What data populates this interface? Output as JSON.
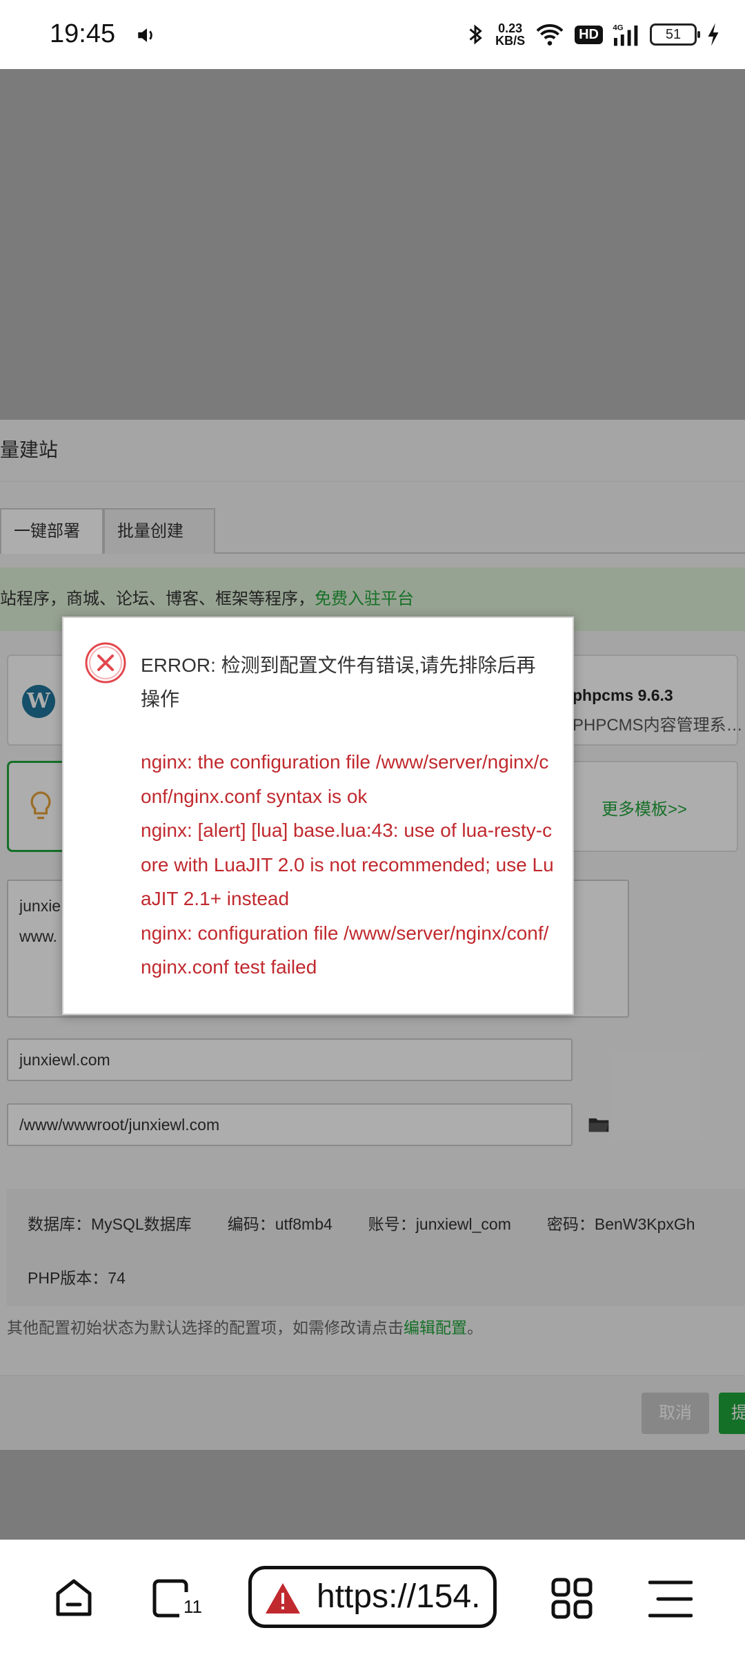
{
  "status_bar": {
    "time": "19:45",
    "speed_value": "0.23",
    "speed_unit": "KB/S",
    "network": "4G",
    "hd_label": "HD",
    "battery": "51"
  },
  "page": {
    "title_partial": "量建站",
    "tabs": [
      "一键部署",
      "批量创建"
    ],
    "notice_text": "站程序，商城、论坛、博客、框架等程序，",
    "notice_link": "免费入驻平台",
    "template1_name": "phpcms 9.6.3",
    "template1_desc": "PHPCMS内容管理系…",
    "more_templates": "更多模板>>",
    "textarea_line1": "junxie",
    "textarea_line2": "www.",
    "domain_value": "junxiewl.com",
    "path_value": "/www/wwwroot/junxiewl.com",
    "info": {
      "db": "数据库：MySQL数据库",
      "encoding": "编码：utf8mb4",
      "account": "账号：junxiewl_com",
      "password": "密码：BenW3KpxGh",
      "php": "PHP版本：74"
    },
    "tip_text": "其他配置初始状态为默认选择的配置项，如需修改请点击",
    "tip_link": "编辑配置",
    "tip_end": "。",
    "cancel_label": "取消",
    "ok_label": "提"
  },
  "dialog": {
    "title": "ERROR: 检测到配置文件有错误,请先排除后再操作",
    "lines": [
      "nginx: the configuration file /www/server/nginx/conf/nginx.conf syntax is ok",
      "nginx: [alert] [lua] base.lua:43: use of lua-resty-core with LuaJIT 2.0 is not recommended; use LuaJIT 2.1+ instead",
      "nginx: configuration file /www/server/nginx/conf/nginx.conf test failed"
    ]
  },
  "browser_bar": {
    "tab_count": "11",
    "url": "https://154."
  },
  "colors": {
    "accent_green": "#20a53a",
    "error_red": "#c0292e"
  },
  "icons": [
    "volume-icon",
    "bluetooth-icon",
    "wifi-icon",
    "signal-icon",
    "battery-icon",
    "charging-icon",
    "wordpress-icon",
    "bulb-icon",
    "folder-icon",
    "error-icon",
    "home-icon",
    "tabs-icon",
    "warning-icon",
    "apps-icon",
    "menu-icon"
  ]
}
